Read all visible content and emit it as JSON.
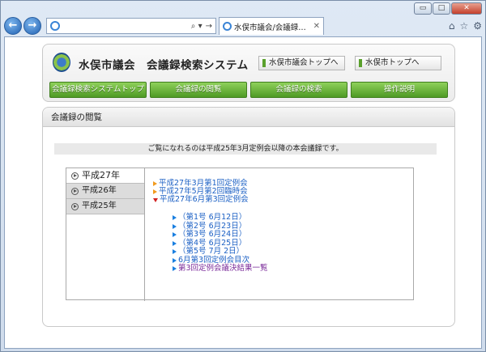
{
  "browser": {
    "address_value": "",
    "tab_title": "水俣市議会/会議録検索シ...",
    "controls": {
      "minimize": "▭",
      "maximize": "□",
      "close": "✕"
    }
  },
  "header": {
    "site_title": "水俣市議会　会議録検索システム",
    "links": [
      "水俣市議会トップへ",
      "水俣市トップへ"
    ]
  },
  "menu": {
    "items": [
      "会議録検索システムトップ",
      "会議録の閲覧",
      "会議録の検索",
      "操作説明"
    ]
  },
  "content": {
    "heading": "会議録の閲覧",
    "notice": "ご覧になれるのは平成25年3月定例会以降の本会議録です。",
    "years": [
      {
        "label": "平成27年",
        "active": true
      },
      {
        "label": "平成26年",
        "active": false
      },
      {
        "label": "平成25年",
        "active": false
      }
    ],
    "sessions": [
      "平成27年3月第1回定例会",
      "平成27年5月第2回臨時会",
      "平成27年6月第3回定例会"
    ],
    "days": [
      "（第1号 6月12日）",
      "（第2号 6月23日）",
      "（第3号 6月24日）",
      "（第4号 6月25日）",
      "（第5号 7月 2日）",
      "6月第3回定例会目次",
      "第3回定例会議決結果一覧"
    ]
  }
}
